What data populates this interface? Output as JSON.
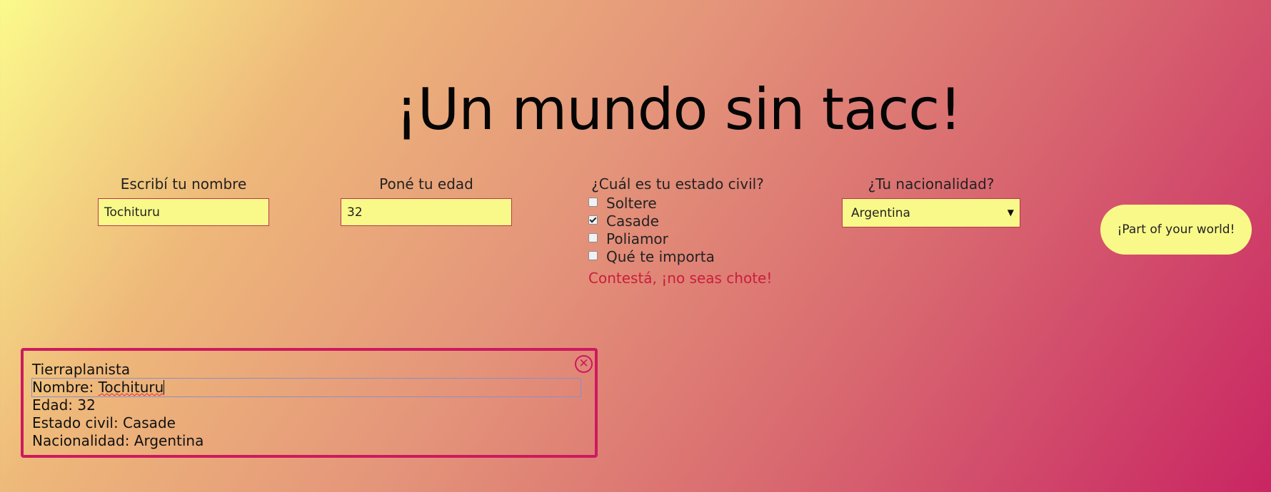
{
  "header": {
    "title": "¡Un mundo sin tacc!"
  },
  "form": {
    "name": {
      "label": "Escribí tu nombre",
      "value": "Tochituru"
    },
    "age": {
      "label": "Poné tu edad",
      "value": "32"
    },
    "marital_status": {
      "label": "¿Cuál es tu estado civil?",
      "options": [
        {
          "label": "Soltere",
          "checked": false
        },
        {
          "label": "Casade",
          "checked": true
        },
        {
          "label": "Poliamor",
          "checked": false
        },
        {
          "label": "Qué te importa",
          "checked": false
        }
      ],
      "error": "Contestá, ¡no seas chote!"
    },
    "nationality": {
      "label": "¿Tu nacionalidad?",
      "selected": "Argentina"
    },
    "submit_label": "¡Part of your world!"
  },
  "summary": {
    "lines": [
      "Tierraplanista",
      "Nombre: ",
      "Edad: 32",
      "Estado civil: Casade",
      "Nacionalidad: Argentina"
    ],
    "misspelled_word": "Tochituru",
    "close_icon": "close-circle-icon"
  },
  "colors": {
    "gradient_start": "#fbfa8c",
    "gradient_end": "#c92562",
    "field_background": "#f9f98a",
    "accent": "#cc1a5e",
    "error": "#c81e3c"
  }
}
